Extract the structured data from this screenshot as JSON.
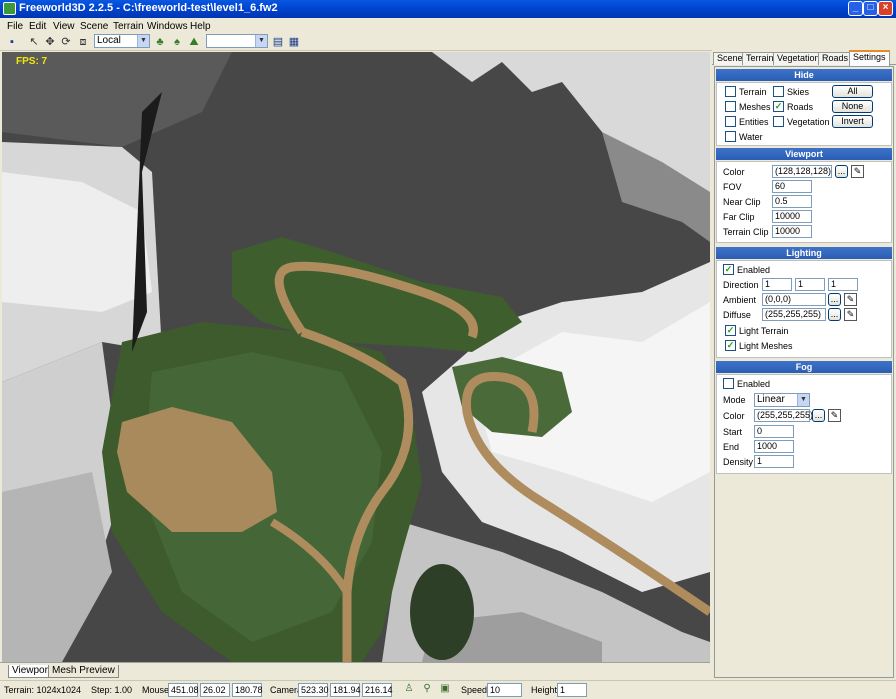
{
  "window": {
    "title": "Freeworld3D 2.2.5 - C:\\freeworld-test\\level1_6.fw2"
  },
  "menu": [
    "File",
    "Edit",
    "View",
    "Scene",
    "Terrain",
    "Windows",
    "Help"
  ],
  "toolbar": {
    "coord_space": "Local",
    "second_select": ""
  },
  "viewport": {
    "fps": "FPS: 7",
    "tabs": [
      "Viewport",
      "Mesh Preview"
    ],
    "background_color": "#808080"
  },
  "panel": {
    "tabs": [
      "Scene",
      "Terrain",
      "Vegetation",
      "Roads",
      "Settings"
    ],
    "active_tab": "Settings",
    "hide": {
      "title": "Hide",
      "terrain": {
        "label": "Terrain",
        "checked": false
      },
      "skies": {
        "label": "Skies",
        "checked": false
      },
      "meshes": {
        "label": "Meshes",
        "checked": false
      },
      "roads": {
        "label": "Roads",
        "checked": true
      },
      "entities": {
        "label": "Entities",
        "checked": false
      },
      "vegetation": {
        "label": "Vegetation",
        "checked": false
      },
      "water": {
        "label": "Water",
        "checked": false
      },
      "all_btn": "All",
      "none_btn": "None",
      "invert_btn": "Invert"
    },
    "viewport_section": {
      "title": "Viewport",
      "color_label": "Color",
      "color": "(128,128,128)",
      "fov_label": "FOV",
      "fov": "60",
      "near_label": "Near Clip",
      "near": "0.5",
      "far_label": "Far Clip",
      "far": "10000",
      "terrain_clip_label": "Terrain Clip",
      "terrain_clip": "10000",
      "browse": "..."
    },
    "lighting": {
      "title": "Lighting",
      "enabled_label": "Enabled",
      "enabled": true,
      "direction_label": "Direction",
      "dir_x": "1",
      "dir_y": "1",
      "dir_z": "1",
      "ambient_label": "Ambient",
      "ambient": "(0,0,0)",
      "diffuse_label": "Diffuse",
      "diffuse": "(255,255,255)",
      "light_terrain_label": "Light Terrain",
      "light_terrain": true,
      "light_meshes_label": "Light Meshes",
      "light_meshes": true,
      "browse": "..."
    },
    "fog": {
      "title": "Fog",
      "enabled_label": "Enabled",
      "enabled": false,
      "mode_label": "Mode",
      "mode": "Linear",
      "color_label": "Color",
      "color": "(255,255,255)",
      "start_label": "Start",
      "start": "0",
      "end_label": "End",
      "end": "1000",
      "density_label": "Density",
      "density": "1",
      "browse": "..."
    }
  },
  "status": {
    "terrain": "Terrain: 1024x1024",
    "step": "Step: 1.00",
    "mouse_label": "Mouse",
    "mouse_x": "451.08",
    "mouse_y": "26.02",
    "mouse_z": "180.78",
    "camera_label": "Camera",
    "camera_x": "523.30",
    "camera_y": "181.94",
    "camera_z": "216.14",
    "speed_label": "Speed",
    "speed": "10",
    "height_label": "Height",
    "height": "1"
  }
}
